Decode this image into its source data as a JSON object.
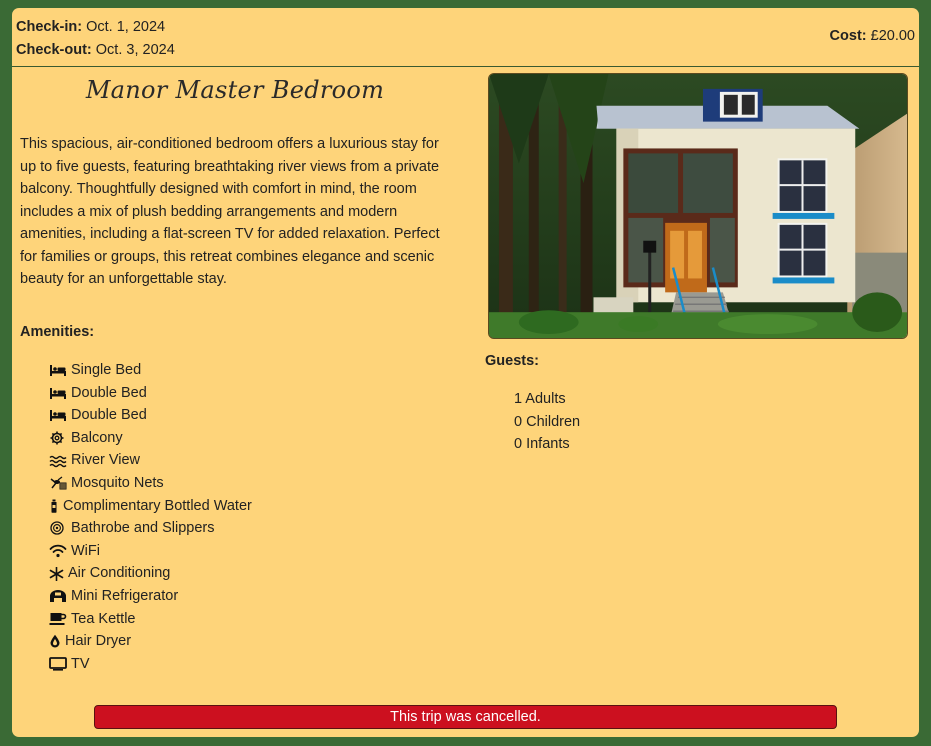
{
  "booking": {
    "checkin_label": "Check-in:",
    "checkin_value": "Oct. 1, 2024",
    "checkout_label": "Check-out:",
    "checkout_value": "Oct. 3, 2024",
    "cost_label": "Cost:",
    "cost_value": "£20.00"
  },
  "room": {
    "title": "Manor Master Bedroom",
    "description": "This spacious, air-conditioned bedroom offers a luxurious stay for up to five guests, featuring breathtaking river views from a private balcony. Thoughtfully designed with comfort in mind, the room includes a mix of plush bedding arrangements and modern amenities, including a flat-screen TV for added relaxation. Perfect for families or groups, this retreat combines elegance and scenic beauty for an unforgettable stay."
  },
  "amenities": {
    "heading": "Amenities:",
    "items": [
      {
        "icon": "bed-icon",
        "label": "Single Bed"
      },
      {
        "icon": "bed-icon",
        "label": "Double Bed"
      },
      {
        "icon": "bed-icon",
        "label": "Double Bed"
      },
      {
        "icon": "gear-icon",
        "label": "Balcony"
      },
      {
        "icon": "water-icon",
        "label": "River View"
      },
      {
        "icon": "mosquito-icon",
        "label": "Mosquito Nets"
      },
      {
        "icon": "bottle-icon",
        "label": "Complimentary Bottled Water"
      },
      {
        "icon": "robe-icon",
        "label": "Bathrobe and Slippers"
      },
      {
        "icon": "wifi-icon",
        "label": "WiFi"
      },
      {
        "icon": "snowflake-icon",
        "label": "Air Conditioning"
      },
      {
        "icon": "fridge-icon",
        "label": "Mini Refrigerator"
      },
      {
        "icon": "kettle-icon",
        "label": "Tea Kettle"
      },
      {
        "icon": "droplet-icon",
        "label": "Hair Dryer"
      },
      {
        "icon": "tv-icon",
        "label": "TV"
      }
    ]
  },
  "guests": {
    "heading": "Guests:",
    "adults": "1 Adults",
    "children": "0 Children",
    "infants": "0 Infants"
  },
  "status": {
    "message": "This trip was cancelled.",
    "color": "#cc101f"
  },
  "colors": {
    "background": "#3a6a35",
    "card": "#fed47a"
  }
}
